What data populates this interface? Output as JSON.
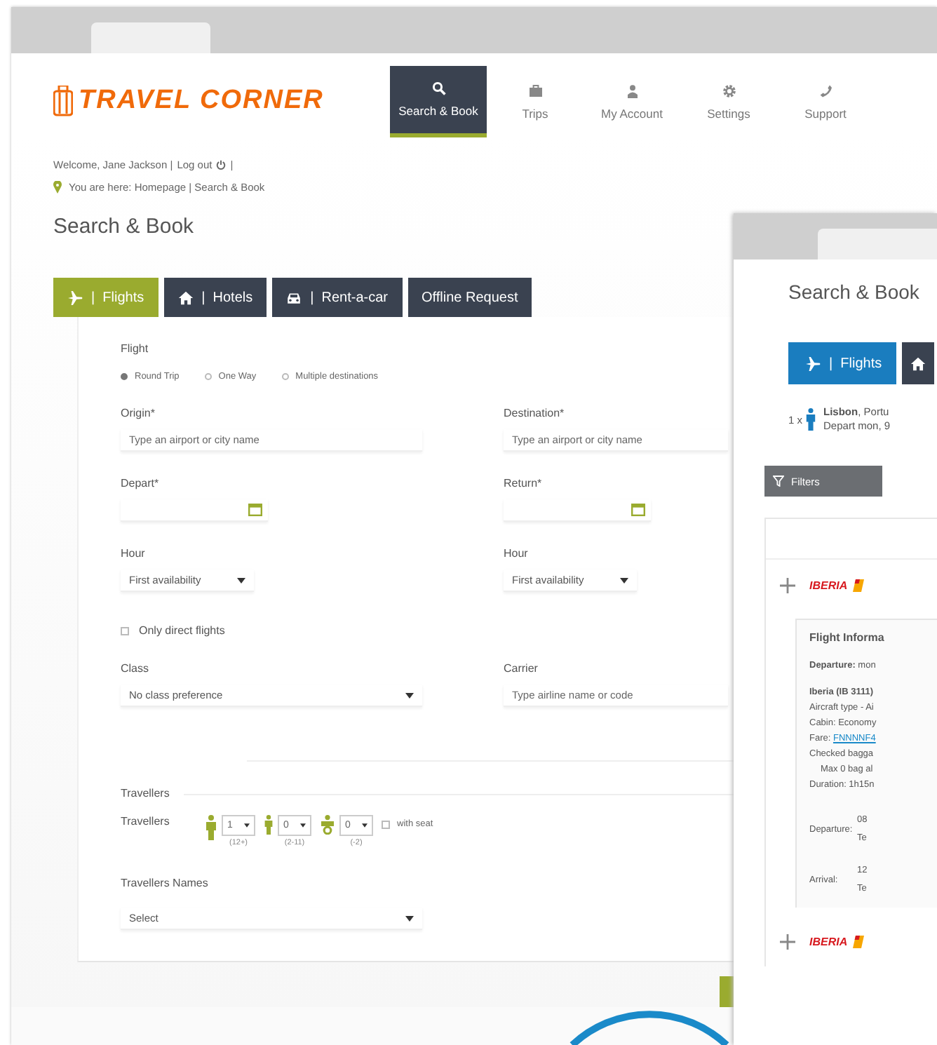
{
  "back_window": {
    "logo": "TRAVEL CORNER",
    "nav": [
      {
        "label": "Search & Book",
        "kind": "search",
        "selected": true
      },
      {
        "label": "Trips",
        "kind": "briefcase",
        "selected": false
      },
      {
        "label": "My Account",
        "kind": "user",
        "selected": false
      },
      {
        "label": "Settings",
        "kind": "gear",
        "selected": false
      },
      {
        "label": "Support",
        "kind": "phone",
        "selected": false
      }
    ],
    "user_bar": {
      "greeting": "Welcome, Jane Jackson  |",
      "logout": "Log out",
      "end": "|"
    },
    "breadcrumb": "You are here: Homepage | Search & Book",
    "title": "Search & Book",
    "tabs": [
      {
        "label": "|  Flights",
        "kind": "plane",
        "selected": true
      },
      {
        "label": "|  Hotels",
        "kind": "home",
        "selected": false
      },
      {
        "label": "|  Rent-a-car",
        "kind": "car",
        "selected": false
      },
      {
        "label": "Offline Request",
        "kind": "text",
        "selected": false
      }
    ],
    "form": {
      "flight_label": "Flight",
      "trip_types": [
        {
          "label": "Round Trip",
          "selected": true
        },
        {
          "label": "One Way",
          "selected": false
        },
        {
          "label": "Multiple destinations",
          "selected": false
        }
      ],
      "origin": {
        "label": "Origin*",
        "placeholder": "Type an airport or city name"
      },
      "destination": {
        "label": "Destination*",
        "placeholder": "Type an airport or city name"
      },
      "depart": {
        "label": "Depart*"
      },
      "return": {
        "label": "Return*"
      },
      "hours": [
        {
          "label": "Hour",
          "value": "First availability"
        },
        {
          "label": "Hour",
          "value": "First availability"
        }
      ],
      "direct_only": {
        "label": "Only direct flights",
        "checked": false
      },
      "class": {
        "label": "Class",
        "value": "No class preference"
      },
      "carrier": {
        "label": "Carrier",
        "placeholder": "Type airline name or code"
      },
      "travellers_heading": "Travellers",
      "travellers": {
        "label": "Travellers",
        "counters": [
          {
            "kind": "adult",
            "value": "1",
            "range": "(12+)"
          },
          {
            "kind": "child",
            "value": "0",
            "range": "(2-11)"
          },
          {
            "kind": "infant",
            "value": "0",
            "range": "(-2)"
          }
        ],
        "with_seat": {
          "label": "with seat",
          "checked": false
        }
      },
      "names": {
        "label": "Travellers Names",
        "value": "Select"
      }
    }
  },
  "front_window": {
    "title": "Search & Book",
    "tabs": [
      {
        "label": "|  Flights",
        "kind": "plane",
        "selected": true
      },
      {
        "kind": "home",
        "selected": false
      }
    ],
    "passengers": {
      "count": "1 x",
      "route": "**Lisbon**, Portu",
      "depart": "Depart mon, 9"
    },
    "filters": "Filters",
    "results": [
      {
        "airline": "IBERIA"
      },
      {
        "airline": "IBERIA"
      }
    ],
    "flight_info": {
      "title": "Flight Informa",
      "departure": "**Departure:** mon",
      "lines": [
        {
          "kind": "bold",
          "text": "Iberia (IB 3111)"
        },
        {
          "kind": "plain",
          "text": "Aircraft type - Ai"
        },
        {
          "kind": "plain",
          "text": "Cabin: Economy"
        },
        {
          "kind": "link",
          "label": "Fare:",
          "text": "FNNNNF4"
        },
        {
          "kind": "plain",
          "text": "Checked bagga"
        },
        {
          "kind": "indent",
          "text": "Max 0 bag al"
        },
        {
          "kind": "plain",
          "text": "Duration: 1h15n"
        }
      ],
      "schedule": [
        {
          "label": "Departure:",
          "time": "08",
          "terminal": "Te"
        },
        {
          "label": "Arrival:",
          "time": "12",
          "terminal": "Te"
        }
      ]
    }
  }
}
